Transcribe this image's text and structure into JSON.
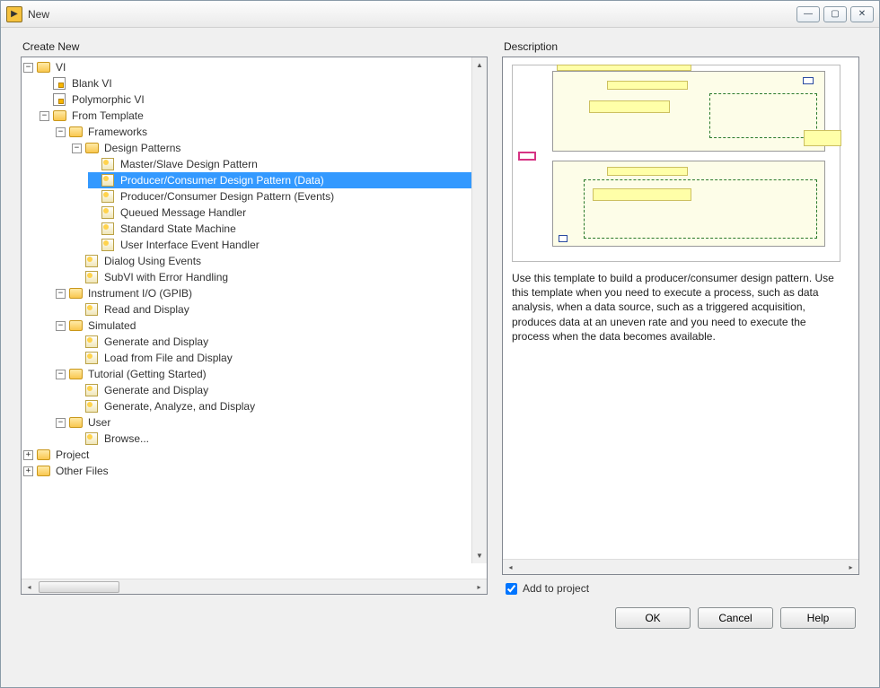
{
  "window": {
    "title": "New"
  },
  "left": {
    "label": "Create New"
  },
  "right": {
    "label": "Description"
  },
  "tree": {
    "vi": "VI",
    "blank_vi": "Blank VI",
    "polymorphic_vi": "Polymorphic VI",
    "from_template": "From Template",
    "frameworks": "Frameworks",
    "design_patterns": "Design Patterns",
    "master_slave": "Master/Slave Design Pattern",
    "prod_cons_data": "Producer/Consumer Design Pattern (Data)",
    "prod_cons_events": "Producer/Consumer Design Pattern (Events)",
    "queued_msg": "Queued Message Handler",
    "std_state": "Standard State Machine",
    "ui_event": "User Interface Event Handler",
    "dialog_events": "Dialog Using Events",
    "subvi_err": "SubVI with Error Handling",
    "instr_io": "Instrument I/O (GPIB)",
    "read_display": "Read and Display",
    "simulated": "Simulated",
    "gen_display": "Generate and Display",
    "load_file": "Load from File and Display",
    "tutorial": "Tutorial (Getting Started)",
    "gen_display2": "Generate and Display",
    "gen_analyze": "Generate, Analyze, and Display",
    "user": "User",
    "browse": "Browse...",
    "project": "Project",
    "other_files": "Other Files"
  },
  "description": {
    "text": "Use this template to build a producer/consumer design pattern. Use this template when you need to execute a process, such as data analysis, when a data source, such as a triggered acquisition, produces data at an uneven rate and you need to execute the process when the data becomes available."
  },
  "checkbox": {
    "label": "Add to project",
    "checked": true
  },
  "buttons": {
    "ok": "OK",
    "cancel": "Cancel",
    "help": "Help"
  }
}
